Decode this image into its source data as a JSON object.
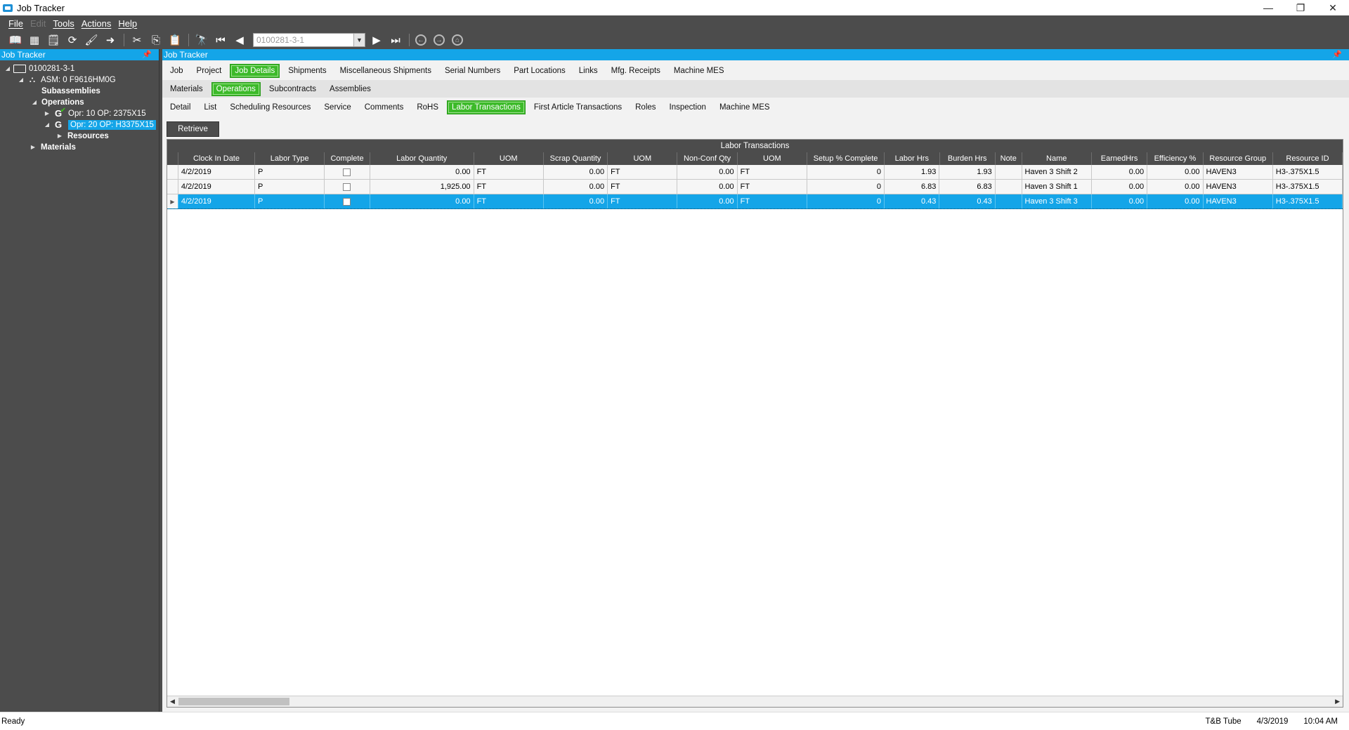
{
  "window": {
    "title": "Job Tracker",
    "minimize": "—",
    "restore": "❐",
    "close": "✕"
  },
  "menu": [
    "File",
    "Edit",
    "Tools",
    "Actions",
    "Help"
  ],
  "toolbar": {
    "job_value": "0100281-3-1"
  },
  "left_panel": {
    "header": "Job Tracker",
    "tree": {
      "root": "0100281-3-1",
      "asm": "ASM: 0 F9616HM0G",
      "subassemblies": "Subassemblies",
      "operations": "Operations",
      "opr10": "Opr: 10 OP: 2375X15",
      "opr20": "Opr: 20 OP: H3375X15",
      "resources": "Resources",
      "materials": "Materials"
    }
  },
  "main": {
    "header": "Job Tracker",
    "tabs_row1": [
      "Job",
      "Project",
      "Job Details",
      "Shipments",
      "Miscellaneous Shipments",
      "Serial Numbers",
      "Part Locations",
      "Links",
      "Mfg. Receipts",
      "Machine MES"
    ],
    "tabs_row2": [
      "Materials",
      "Operations",
      "Subcontracts",
      "Assemblies"
    ],
    "tabs_row3": [
      "Detail",
      "List",
      "Scheduling Resources",
      "Service",
      "Comments",
      "RoHS",
      "Labor Transactions",
      "First Article Transactions",
      "Roles",
      "Inspection",
      "Machine MES"
    ],
    "active_row1": "Job Details",
    "active_row2": "Operations",
    "active_row3": "Labor Transactions",
    "retrieve_label": "Retrieve"
  },
  "grid": {
    "title": "Labor Transactions",
    "columns": [
      "Clock In Date",
      "Labor Type",
      "Complete",
      "Labor Quantity",
      "UOM",
      "Scrap Quantity",
      "UOM",
      "Non-Conf Qty",
      "UOM",
      "Setup % Complete",
      "Labor Hrs",
      "Burden Hrs",
      "Note",
      "Name",
      "EarnedHrs",
      "Efficiency %",
      "Resource Group",
      "Resource ID"
    ],
    "rows": [
      [
        "4/2/2019",
        "P",
        "",
        "0.00",
        "FT",
        "0.00",
        "FT",
        "0.00",
        "FT",
        "0",
        "1.93",
        "1.93",
        "",
        "Haven 3 Shift 2",
        "0.00",
        "0.00",
        "HAVEN3",
        "H3-.375X1.5"
      ],
      [
        "4/2/2019",
        "P",
        "",
        "1,925.00",
        "FT",
        "0.00",
        "FT",
        "0.00",
        "FT",
        "0",
        "6.83",
        "6.83",
        "",
        "Haven 3 Shift 1",
        "0.00",
        "0.00",
        "HAVEN3",
        "H3-.375X1.5"
      ],
      [
        "4/2/2019",
        "P",
        "",
        "0.00",
        "FT",
        "0.00",
        "FT",
        "0.00",
        "FT",
        "0",
        "0.43",
        "0.43",
        "",
        "Haven 3 Shift 3",
        "0.00",
        "0.00",
        "HAVEN3",
        "H3-.375X1.5"
      ]
    ],
    "selected_row": 2
  },
  "status": {
    "left": "Ready",
    "company": "T&B Tube",
    "date": "4/3/2019",
    "time": "10:04 AM"
  }
}
